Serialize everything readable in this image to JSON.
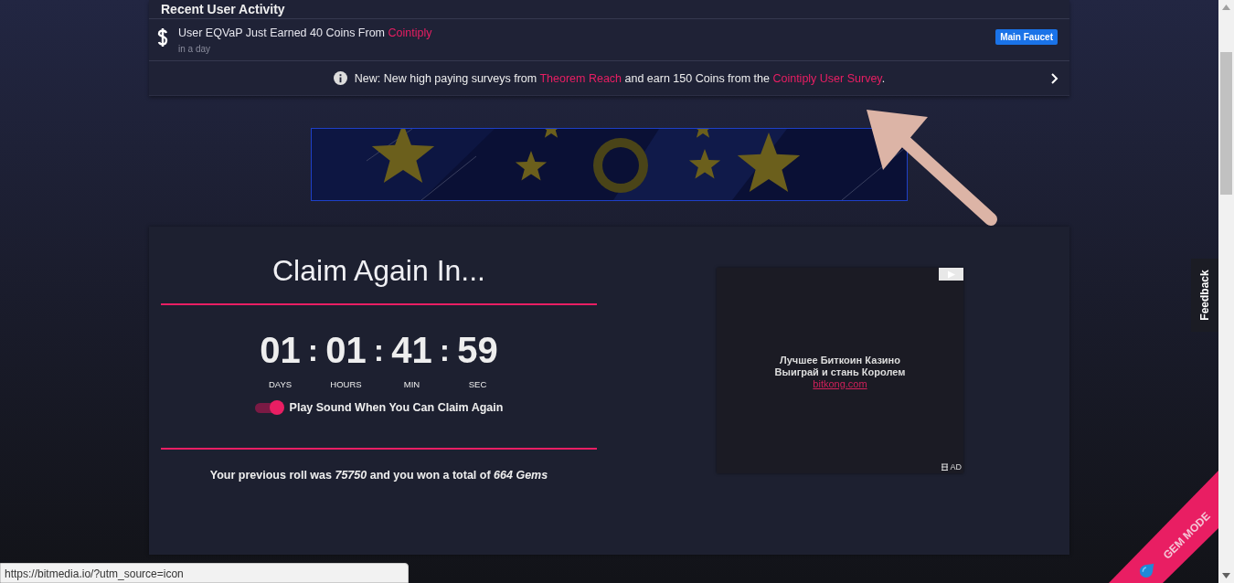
{
  "activity": {
    "title": "Recent User Activity",
    "items": [
      {
        "parts": [
          {
            "kind": "text",
            "text": "User EQVaP Just Earned 40 Coins From "
          },
          {
            "kind": "link",
            "text": "Cointiply"
          }
        ],
        "time": "in a day",
        "tag": "Main Faucet"
      }
    ],
    "notice": {
      "parts": [
        {
          "kind": "text",
          "text": "New: New high paying surveys from "
        },
        {
          "kind": "link",
          "text": "Theorem Reach"
        },
        {
          "kind": "text",
          "text": " and earn 150 Coins from the "
        },
        {
          "kind": "link",
          "text": "Cointiply User Survey"
        },
        {
          "kind": "text",
          "text": "."
        }
      ]
    }
  },
  "claim": {
    "title": "Claim Again In...",
    "separator": ":",
    "units": [
      {
        "value": "01",
        "label": "DAYS"
      },
      {
        "value": "01",
        "label": "HOURS"
      },
      {
        "value": "41",
        "label": "MIN"
      },
      {
        "value": "59",
        "label": "SEC"
      }
    ],
    "sound_toggle": {
      "label": "Play Sound When You Can Claim Again",
      "on": true
    },
    "previous_roll": "Your previous roll was *75750* and you won a total of *664 Gems*"
  },
  "ad": {
    "lines": [
      "Лучшее Биткоин Казино",
      "Выиграй и стань Королем"
    ],
    "link": "bitkong.com",
    "badge": "AD"
  },
  "feedback_tab": "Feedback",
  "gem_mode": "GEM MODE",
  "status_url": "https://bitmedia.io/?utm_source=icon"
}
